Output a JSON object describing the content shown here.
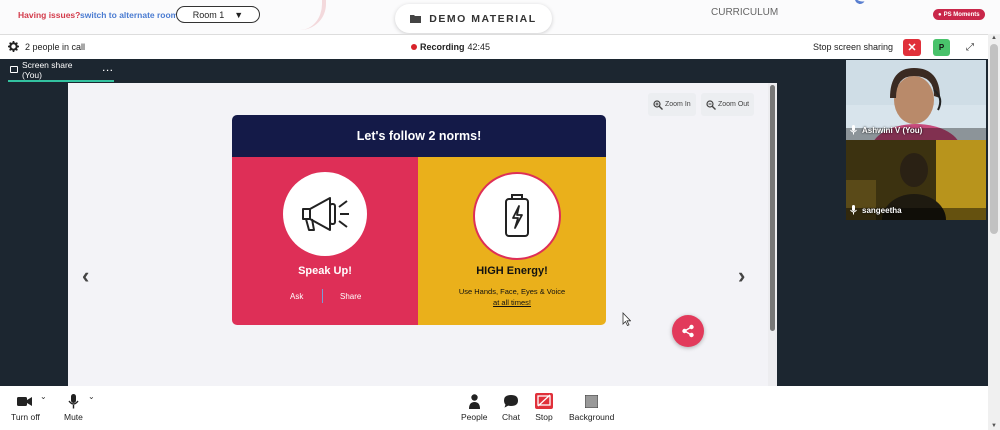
{
  "topbar": {
    "issues_text": "Having issues?",
    "alt_room_link": "switch to alternate room",
    "room_select_value": "Room 1",
    "demo_material_label": "DEMO MATERIAL",
    "curriculum_label": "CURRICULUM",
    "ps_moments_label": "PS Moments"
  },
  "call_header": {
    "people_count": "2 people in call",
    "recording_label": "Recording",
    "recording_time": "42:45",
    "stop_share_label": "Stop screen sharing",
    "participant_initial": "P"
  },
  "share_tab": {
    "label": "Screen share (You)",
    "more": "···"
  },
  "viewer": {
    "zoom_in": "Zoom In",
    "zoom_out": "Zoom Out"
  },
  "slide": {
    "title": "Let's follow 2 norms!",
    "left": {
      "title": "Speak Up!",
      "ask": "Ask",
      "share": "Share",
      "icon": "megaphone-icon"
    },
    "right": {
      "title": "HIGH Energy!",
      "desc": "Use Hands, Face, Eyes & Voice",
      "emphasis": "at all times!",
      "icon": "battery-charging-icon"
    }
  },
  "participants": [
    {
      "name": "Ashwini V (You)"
    },
    {
      "name": "sangeetha"
    }
  ],
  "bottom_bar": {
    "turn_off": "Turn off",
    "mute": "Mute",
    "people": "People",
    "chat": "Chat",
    "stop": "Stop",
    "background": "Background"
  },
  "colors": {
    "accent_teal": "#33c2a0",
    "record_red": "#d8232a",
    "slide_navy": "#141a48",
    "slide_pink": "#de2f57",
    "slide_yellow": "#eab01b",
    "fab_pink": "#e23a5b"
  }
}
